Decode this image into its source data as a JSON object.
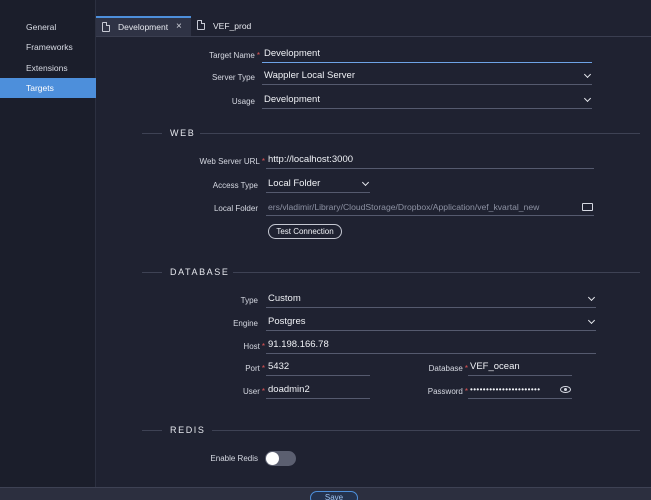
{
  "sidebar": {
    "items": [
      {
        "label": "General"
      },
      {
        "label": "Frameworks"
      },
      {
        "label": "Extensions"
      },
      {
        "label": "Targets"
      }
    ]
  },
  "tabs": [
    {
      "label": "Development",
      "close": "×"
    },
    {
      "label": "VEF_prod"
    }
  ],
  "general": {
    "target_name_label": "Target Name",
    "target_name_value": "Development",
    "server_type_label": "Server Type",
    "server_type_value": "Wappler Local Server",
    "usage_label": "Usage",
    "usage_value": "Development"
  },
  "web": {
    "title": "WEB",
    "url_label": "Web Server URL",
    "url_value": "http://localhost:3000",
    "access_label": "Access Type",
    "access_value": "Local Folder",
    "folder_label": "Local Folder",
    "folder_value": "ers/vladimir/Library/CloudStorage/Dropbox/Application/vef_kvartal_new",
    "test_button": "Test Connection"
  },
  "database": {
    "title": "DATABASE",
    "type_label": "Type",
    "type_value": "Custom",
    "engine_label": "Engine",
    "engine_value": "Postgres",
    "host_label": "Host",
    "host_value": "91.198.166.78",
    "port_label": "Port",
    "port_value": "5432",
    "db_label": "Database",
    "db_value": "VEF_ocean",
    "user_label": "User",
    "user_value": "doadmin2",
    "password_label": "Password",
    "password_value": "••••••••••••••••••••••"
  },
  "redis": {
    "title": "REDIS",
    "enable_label": "Enable Redis",
    "enabled": false
  },
  "footer": {
    "save_label": "Save"
  }
}
